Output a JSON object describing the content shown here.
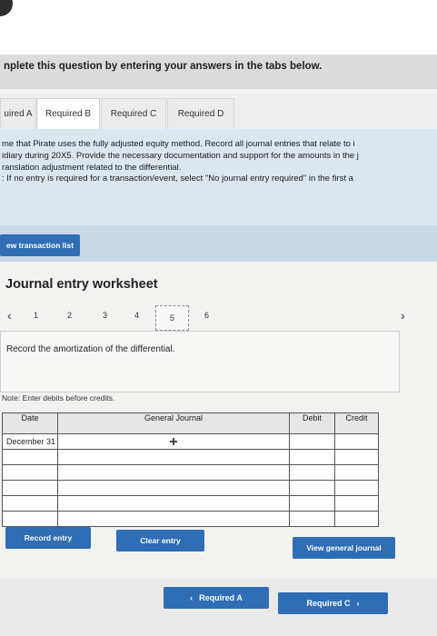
{
  "header": {
    "instruction": "nplete this question by entering your answers in the tabs below."
  },
  "tabs": [
    {
      "label": "uired A",
      "active": false
    },
    {
      "label": "Required B",
      "active": true
    },
    {
      "label": "Required C",
      "active": false
    },
    {
      "label": "Required D",
      "active": false
    }
  ],
  "info": {
    "lines": [
      "me that Pirate uses the fully adjusted equity method. Record all journal entries that relate to i",
      "idiary during 20X5. Provide the necessary documentation and support for the amounts in the j",
      "ranslation adjustment related to the differential.",
      ": If no entry is required for a transaction/event, select \"No journal entry required\" in the first a"
    ]
  },
  "transaction_list_button": "ew transaction list",
  "worksheet": {
    "title": "Journal entry worksheet",
    "prev_icon": "chevron-left-icon",
    "next_icon": "chevron-right-icon",
    "pages": [
      "1",
      "2",
      "3",
      "4",
      "5",
      "6"
    ],
    "current_page": "5",
    "description": "Record the amortization of the differential.",
    "note": "Note: Enter debits before credits."
  },
  "journal_table": {
    "headers": {
      "date": "Date",
      "account": "General Journal",
      "debit": "Debit",
      "credit": "Credit"
    },
    "rows": [
      {
        "date": "December 31",
        "account": "",
        "debit": "",
        "credit": ""
      },
      {
        "date": "",
        "account": "",
        "debit": "",
        "credit": ""
      },
      {
        "date": "",
        "account": "",
        "debit": "",
        "credit": ""
      },
      {
        "date": "",
        "account": "",
        "debit": "",
        "credit": ""
      },
      {
        "date": "",
        "account": "",
        "debit": "",
        "credit": ""
      },
      {
        "date": "",
        "account": "",
        "debit": "",
        "credit": ""
      }
    ]
  },
  "actions": {
    "record_entry": "Record entry",
    "clear_entry": "Clear entry",
    "view_general_journal": "View general journal"
  },
  "footer": {
    "prev_label": "Required A",
    "next_label": "Required C",
    "prev_icon": "chevron-left-icon",
    "next_icon": "chevron-right-icon"
  },
  "colors": {
    "button_blue": "#2f6db5",
    "info_bg": "#dbe6ef",
    "panel_bg": "#c9d8e6"
  }
}
